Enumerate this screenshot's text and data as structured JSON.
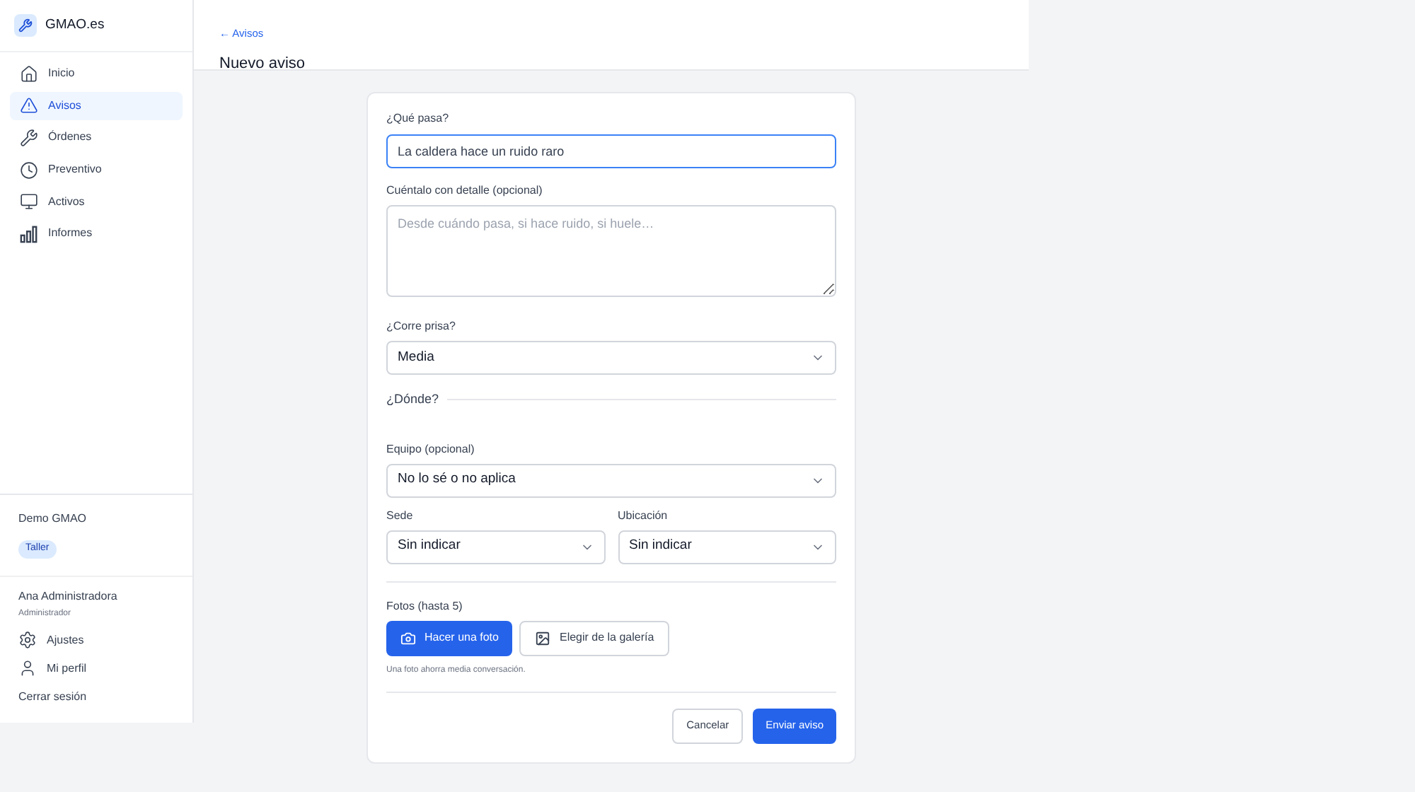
{
  "brand": "GMAO.es",
  "nav": [
    {
      "kind": "home",
      "label": "Inicio",
      "selected": false
    },
    {
      "kind": "alert",
      "label": "Avisos",
      "selected": true
    },
    {
      "kind": "tools",
      "label": "Órdenes",
      "selected": false
    },
    {
      "kind": "clock",
      "label": "Preventivo",
      "selected": false
    },
    {
      "kind": "asset",
      "label": "Activos",
      "selected": false
    },
    {
      "kind": "chart",
      "label": "Informes",
      "selected": false
    }
  ],
  "org": {
    "name": "Demo GMAO",
    "badge": "Taller"
  },
  "user": {
    "name": "Ana Administradora",
    "role": "Administrador"
  },
  "user_links": [
    {
      "kind": "gear",
      "label": "Ajustes"
    },
    {
      "kind": "person",
      "label": "Mi perfil"
    },
    {
      "kind": "none",
      "label": "Cerrar sesión"
    }
  ],
  "header": {
    "back": "← Avisos",
    "title": "Nuevo aviso"
  },
  "form": {
    "what": {
      "label": "¿Qué pasa?",
      "value": "La caldera hace un ruido raro"
    },
    "detail": {
      "label": "Cuéntalo con detalle (opcional)",
      "placeholder": "Desde cuándo pasa, si hace ruido, si huele…"
    },
    "urgency": {
      "label": "¿Corre prisa?",
      "value": "Media"
    },
    "where": "¿Dónde?",
    "equipment": {
      "label": "Equipo (opcional)",
      "value": "No lo sé o no aplica"
    },
    "site": {
      "label": "Sede",
      "value": "Sin indicar"
    },
    "location": {
      "label": "Ubicación",
      "value": "Sin indicar"
    },
    "photos": {
      "label": "Fotos (hasta 5)",
      "take": "Hacer una foto",
      "gallery": "Elegir de la galería",
      "hint": "Una foto ahorra media conversación."
    },
    "cancel": "Cancelar",
    "submit": "Enviar aviso"
  }
}
